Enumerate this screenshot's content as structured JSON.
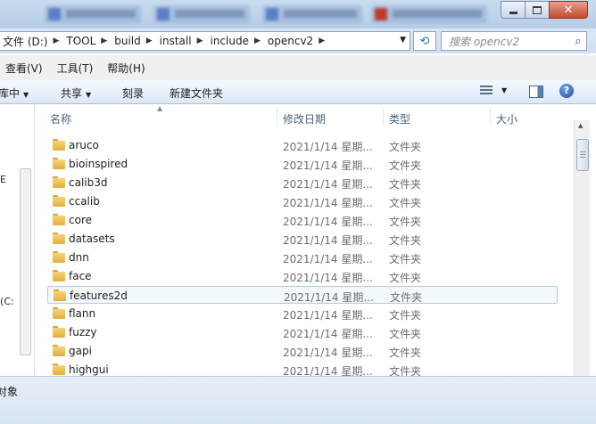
{
  "window": {
    "controls": {
      "minimize_icon": "minimize-icon",
      "maximize_icon": "maximize-icon",
      "close_icon": "close-icon",
      "close_glyph": "✕"
    }
  },
  "address": {
    "crumbs": [
      "文件 (D:)",
      "TOOL",
      "build",
      "install",
      "include",
      "opencv2"
    ],
    "refresh_glyph": "⟲",
    "search_placeholder": "搜索 opencv2",
    "search_icon": "⌕"
  },
  "menu": {
    "items": [
      "查看(V)",
      "工具(T)",
      "帮助(H)"
    ]
  },
  "toolbar": {
    "organize": "库中",
    "share": "共享",
    "burn": "刻录",
    "new_folder": "新建文件夹",
    "help": "?"
  },
  "nav": {
    "fragment_1": "E",
    "fragment_2": "(C:"
  },
  "columns": {
    "name": "名称",
    "date": "修改日期",
    "type": "类型",
    "size": "大小"
  },
  "files": [
    {
      "name": "aruco",
      "date": "2021/1/14 星期...",
      "type": "文件夹"
    },
    {
      "name": "bioinspired",
      "date": "2021/1/14 星期...",
      "type": "文件夹"
    },
    {
      "name": "calib3d",
      "date": "2021/1/14 星期...",
      "type": "文件夹"
    },
    {
      "name": "ccalib",
      "date": "2021/1/14 星期...",
      "type": "文件夹"
    },
    {
      "name": "core",
      "date": "2021/1/14 星期...",
      "type": "文件夹"
    },
    {
      "name": "datasets",
      "date": "2021/1/14 星期...",
      "type": "文件夹"
    },
    {
      "name": "dnn",
      "date": "2021/1/14 星期...",
      "type": "文件夹"
    },
    {
      "name": "face",
      "date": "2021/1/14 星期...",
      "type": "文件夹"
    },
    {
      "name": "features2d",
      "date": "2021/1/14 星期...",
      "type": "文件夹"
    },
    {
      "name": "flann",
      "date": "2021/1/14 星期...",
      "type": "文件夹"
    },
    {
      "name": "fuzzy",
      "date": "2021/1/14 星期...",
      "type": "文件夹"
    },
    {
      "name": "gapi",
      "date": "2021/1/14 星期...",
      "type": "文件夹"
    },
    {
      "name": "highgui",
      "date": "2021/1/14 星期...",
      "type": "文件夹"
    }
  ],
  "status": {
    "text": "对象"
  },
  "colors": {
    "folder": "#e8b445",
    "hover_border": "#a9cbee",
    "accent": "#2a6fc0"
  }
}
